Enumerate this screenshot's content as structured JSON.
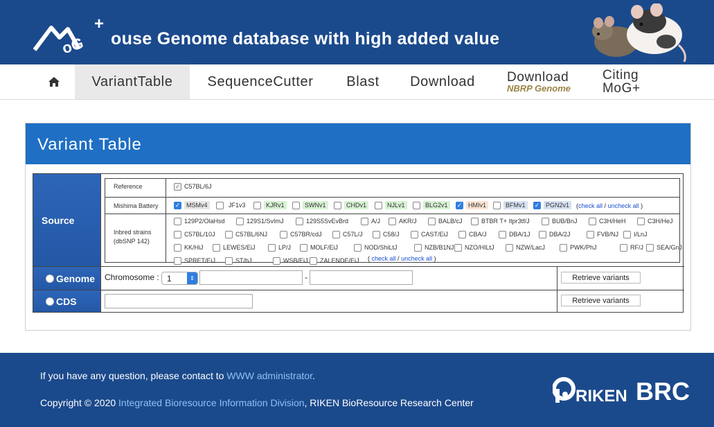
{
  "header": {
    "logo_text": "MoG+",
    "title": "ouse Genome database with high added value"
  },
  "nav": {
    "home_icon": "home-icon",
    "items": [
      {
        "label": "VariantTable"
      },
      {
        "label": "SequenceCutter"
      },
      {
        "label": "Blast"
      },
      {
        "label": "Download"
      }
    ],
    "download_nbrp": {
      "label": "Download",
      "sub": "NBRP Genome"
    },
    "citing": {
      "line1": "Citing",
      "line2": "MoG+"
    }
  },
  "panel": {
    "title": "Variant Table",
    "source_label": "Source",
    "reference": {
      "label": "Reference",
      "strain": "C57BL/6J"
    },
    "mishima": {
      "label": "Mishima Battery",
      "strains": [
        {
          "name": "MSMv4",
          "checked": true,
          "bg": "#e6e6e6"
        },
        {
          "name": "JF1v3",
          "checked": false,
          "bg": "#ffffff"
        },
        {
          "name": "KJRv1",
          "checked": false,
          "bg": "#d7f2d3"
        },
        {
          "name": "SWNv1",
          "checked": false,
          "bg": "#d7f2d3"
        },
        {
          "name": "CHDv1",
          "checked": false,
          "bg": "#d7f2d3"
        },
        {
          "name": "NJLv1",
          "checked": false,
          "bg": "#d7f2d3"
        },
        {
          "name": "BLG2v1",
          "checked": false,
          "bg": "#d7f2d3"
        },
        {
          "name": "HMIv1",
          "checked": true,
          "bg": "#fbe3d3"
        },
        {
          "name": "BFMv1",
          "checked": false,
          "bg": "#d6e0f0"
        },
        {
          "name": "PGN2v1",
          "checked": true,
          "bg": "#d6e0f0"
        }
      ],
      "check_all": "check all",
      "uncheck_all": "uncheck all",
      "open": "(",
      "sep": "/",
      "close": ")"
    },
    "inbred": {
      "label_line1": "Inbred strains",
      "label_line2": "(dbSNP 142)",
      "strains": [
        "129P2/OlaHsd",
        "129S1/SvImJ",
        "129S5SvEvBrd",
        "A/J",
        "AKR/J",
        "BALB/cJ",
        "BTBR T+ Itpr3tf/J",
        "BUB/BnJ",
        "C3H/HeH",
        "C3H/HeJ",
        "C57BL/10J",
        "C57BL/6NJ",
        "C57BR/cdJ",
        "C57L/J",
        "C58/J",
        "CAST/EiJ",
        "CBA/J",
        "DBA/1J",
        "DBA/2J",
        "FVB/NJ",
        "I/LnJ",
        "KK/HiJ",
        "LEWES/EiJ",
        "LP/J",
        "MOLF/EiJ",
        "NOD/ShiLtJ",
        "NZB/B1NJ",
        "NZO/HILtJ",
        "NZW/LacJ",
        "PWK/PhJ",
        "RF/J",
        "SEA/GnJ",
        "SPRET/EiJ",
        "ST/bJ",
        "WSB/EiJ",
        "ZALENDE/EiJ"
      ],
      "check_all": "check all",
      "uncheck_all": "uncheck all",
      "open": "(",
      "sep": "/",
      "close": ")"
    },
    "genome": {
      "label": "Genome",
      "chromosome_label": "Chromosome :",
      "chromosome_value": "1",
      "range_sep": "-",
      "start_value": "",
      "end_value": "",
      "button": "Retrieve variants"
    },
    "cds": {
      "label": "CDS",
      "input_value": "",
      "button": "Retrieve variants"
    }
  },
  "footer": {
    "question_text": "If you have any question, please contact to",
    "admin_link": "WWW administrator",
    "period": ".",
    "copyright_prefix": "Copyright © 2020",
    "division_link": "Integrated Bioresource Information Division",
    "copyright_suffix": ", RIKEN BioResource Research Center",
    "brand": "RIKEN BRC"
  },
  "colors": {
    "brand_blue": "#1b4a8c",
    "panel_blue": "#1f6fc4",
    "check_blue": "#2f7ee0"
  }
}
